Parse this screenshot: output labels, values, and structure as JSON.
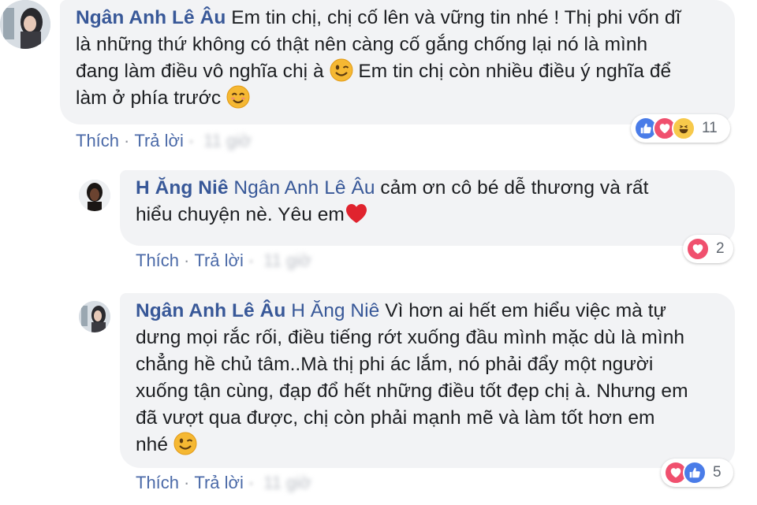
{
  "comments": [
    {
      "author": "Ngân Anh Lê Âu",
      "mention": "",
      "text_lines": [
        "Em tin chị, chị cố lên và vững tin nhé ! Thị phi vốn dĩ",
        "là những thứ không có thật nên càng cố gắng chống lại nó là mình",
        "đang làm điều vô nghĩa chị à",
        "Em tin chị còn nhiều điều ý nghĩa để",
        "làm ở phía trước"
      ],
      "actions": {
        "like": "Thích",
        "reply": "Trả lời",
        "time": "11 giờ"
      },
      "reactions": [
        "like",
        "love",
        "haha"
      ],
      "reaction_count": "11"
    },
    {
      "author": "H Ăng Niê",
      "mention": "Ngân Anh Lê Âu",
      "text_lines": [
        "cảm ơn cô bé dễ thương và rất",
        "hiểu chuyện nè. Yêu em"
      ],
      "actions": {
        "like": "Thích",
        "reply": "Trả lời",
        "time": "11 giờ"
      },
      "reactions": [
        "love"
      ],
      "reaction_count": "2"
    },
    {
      "author": "Ngân Anh Lê Âu",
      "mention": "H Ăng Niê",
      "text_lines": [
        "Vì hơn ai hết em hiểu việc mà tự",
        "dưng mọi rắc rối, điều tiếng rớt xuống đầu mình mặc dù là mình",
        "chẳng hề chủ tâm..Mà thị phi ác lắm, nó phải đẩy một người",
        "xuống tận cùng, đạp đổ hết những điều tốt đẹp chị à. Nhưng em",
        "đã vượt qua được, chị còn phải mạnh mẽ và làm tốt hơn em",
        "nhé"
      ],
      "actions": {
        "like": "Thích",
        "reply": "Trả lời",
        "time": "11 giờ"
      },
      "reactions": [
        "love",
        "like"
      ],
      "reaction_count": "5"
    }
  ],
  "colors": {
    "author": "#385898",
    "bubble": "#f2f3f5",
    "action_link": "#4b6aa8",
    "like": "#4a7ce8",
    "love": "#f0506e",
    "haha": "#f7c94b"
  }
}
